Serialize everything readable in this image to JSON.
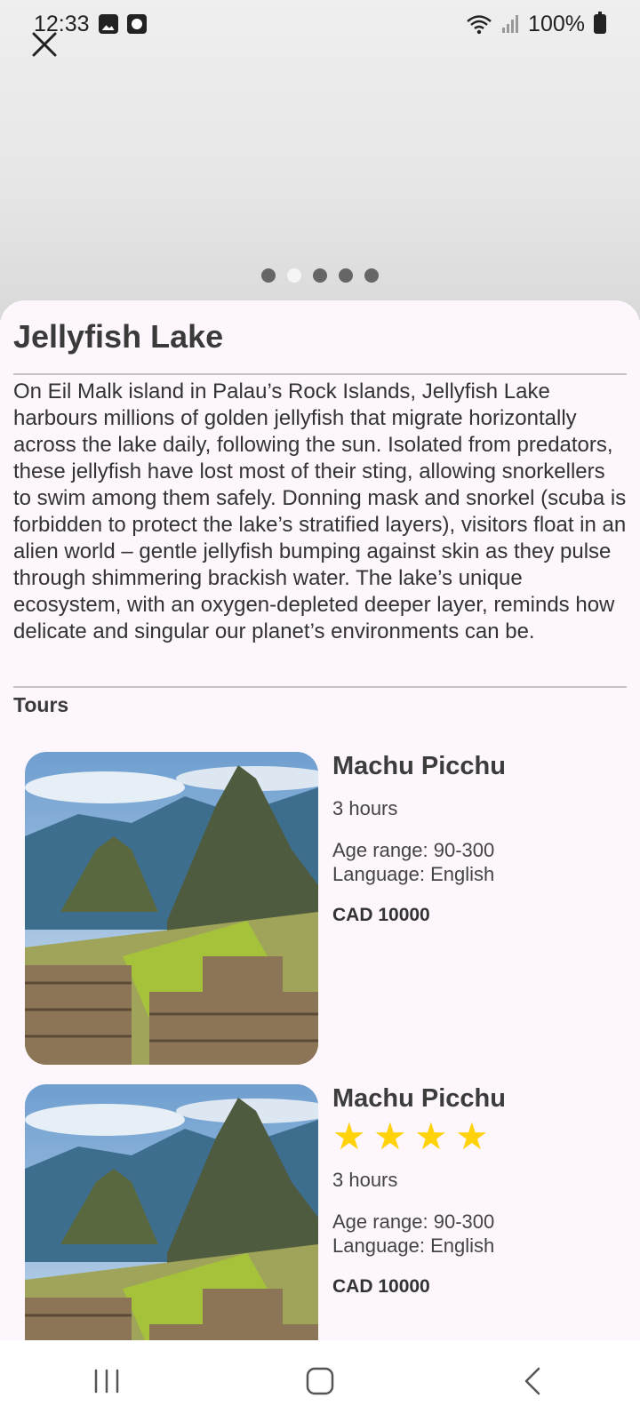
{
  "status_bar": {
    "time": "12:33",
    "battery": "100%",
    "icons": [
      "image-icon",
      "clock-app-icon",
      "wifi-icon",
      "signal-icon",
      "battery-charging-icon"
    ]
  },
  "gallery": {
    "close_icon": "close-icon",
    "page_count": 5,
    "active_page": 2
  },
  "attraction": {
    "title": "Jellyfish Lake",
    "description": "On Eil Malk island in Palau’s Rock Islands, Jellyfish Lake harbours millions of golden jellyfish that migrate horizontally across the lake daily, following the sun. Isolated from predators, these jellyfish have lost most of their sting, allowing snorkellers to swim among them safely. Donning mask and snorkel (scuba is forbidden to protect the lake’s stratified layers), visitors float in an alien world – gentle jellyfish bumping against skin as they pulse through shimmering brackish water. The lake’s unique ecosystem, with an oxygen-depleted deeper layer, reminds how delicate and singular our planet’s environments can be."
  },
  "tours_section": {
    "heading": "Tours",
    "items": [
      {
        "name": "Machu Picchu",
        "rating": null,
        "duration": "3 hours",
        "age_range": "Age range: 90-300",
        "language": "Language: English",
        "price": "CAD 10000"
      },
      {
        "name": "Machu Picchu",
        "rating": 4,
        "duration": "3 hours",
        "age_range": "Age range: 90-300",
        "language": "Language: English",
        "price": "CAD 10000"
      }
    ]
  },
  "colors": {
    "star": "#ffd20a",
    "sheet_bg": "#fdf6fd",
    "text": "#2a2a2a"
  },
  "navigation": {
    "icons": [
      "recent-apps-icon",
      "home-icon",
      "back-icon"
    ]
  }
}
